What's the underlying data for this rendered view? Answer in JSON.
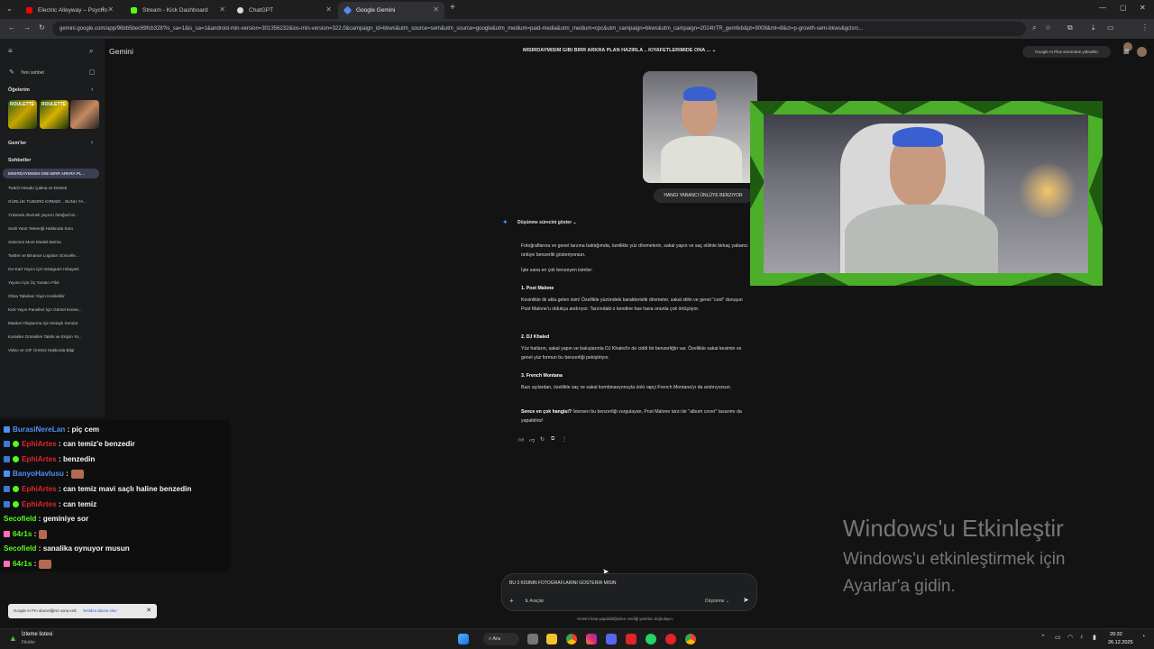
{
  "tabs": [
    {
      "label": "Electric Alleyway – Psycho",
      "color": "#ff0000"
    },
    {
      "label": "Stream - Kick Dashboard",
      "color": "#53fc18"
    },
    {
      "label": "ChatGPT",
      "color": "#ffffff"
    },
    {
      "label": "Google Gemini",
      "color": "#4e8cf5"
    }
  ],
  "new_tab": "+",
  "url": "gemini.google.com/app/96bb5bec69fcb328?is_sa=1&is_sa=1&android-min-version=301356232&ios-min-version=322.0&campaign_id=bkws&utm_source=sem&utm_source=google&utm_medium=paid-media&utm_medium=cpc&utm_campaign=bkws&utm_campaign=2024trTR_gemfeb&pt=9008&mt=8&ct=p-growth-sem-bkws&gclsrc...",
  "brand": "Gemini",
  "conversation_title": "MISIRDAYMISIM GIBI BIRR ARKRA PLAN HAZIRLA .. KIYAFETLERIMIDE ONA ...",
  "upgrade_label": "Google AI Plus sürümüne yükseltin",
  "sidebar": {
    "new_chat": "Yeni sohbet",
    "gems_heading": "Öğelerim",
    "gem_list_heading": "Gem'ler",
    "chats_heading": "Sohbetler",
    "chats": [
      "MISIRDAYMISIM GIBI BIRR ARKRA PL...",
      "Twitch Hesabı Çalma ve Destek",
      "GÜRLÜK TUBORG KIRMIZI .. BUNU YA...",
      "Yüzünde dövmeli yayıncı fotoğraf ist...",
      "Sesli Yanıt Yeteneği Hakkında Soru",
      "Salomon Mont Modeli Bulma",
      "Twitter ve Binance Logoları Güncelle...",
      "Go-Kart Yayını için Instagram Hikayesi",
      "Yayıncı İçin Üç Yaratıcı Fikir",
      "Obsa Tabelası Yayın Kesilebilir",
      "Kick Yayın Panelleri İçin Görsel Konse...",
      "Maskot Oluşturma İçin Detaylı Sorular",
      "Karakter Görselleri Talebi ve Erişim Yo...",
      "Video ve GIF Üretimi Hakkında Bilgi"
    ]
  },
  "user_message": "HANGI YABANCI ÜNLÜYE BENZIYOR",
  "thinking_label": "Düşünme sürecini göster",
  "response": {
    "intro": "Fotoğraflarına ve genel tarzına baktığımda, özellikle yüz dövmelerin, sakal yapın ve saç stilinle birkaç yabancı ünlüye benzerlik gösteriyorsun.",
    "lead": "İşte sana en çok benzeyen isimler:",
    "items": [
      {
        "title": "1. Post Malone",
        "body": "Kesinlikle ilk akla gelen isim! Özellikle yüzündeki karakteristik dövmeler, sakal stilin ve genel \"cool\" duruşun Post Malone'u oldukça andırıyor. Tarzındaki o kendine has hava onunla çok örtüşüyor."
      },
      {
        "title": "2. DJ Khaled",
        "body": "Yüz hatların, sakal yapın ve bakışlarınla DJ Khaled'e de ciddi bir benzerliğin var. Özellikle sakal kesimin ve genel yüz formun bu benzerliği pekiştiriyor."
      },
      {
        "title": "3. French Montana",
        "body": "Bazı açılardan, özellikle saç ve sakal kombinasyonuyla ünlü rapçi French Montana'yı da andırıyorsun."
      }
    ],
    "closing_bold": "Sence en çok hangisi?",
    "closing": " İstersen bu benzerliği vurgulayan, Post Malone tarzı bir \"album cover\" tasarımı da yapabiliriz!"
  },
  "input": {
    "value": "BU 3 KISININ FOTOGRAFLARINI GOSTERIR MISIN",
    "tools_label": "Araçlar",
    "mode_label": "Düşünme"
  },
  "disclaimer": "Gemini hata yapabildiğinden verdiği yanıtları doğrulayın.",
  "stream_chat": [
    {
      "user": "BurasiNereLan",
      "color": "#4f8ef7",
      "msg": "piç cem",
      "emote": false
    },
    {
      "user": "EphiArtes",
      "color": "#e0242c",
      "msg": "can temiz'e benzedir",
      "emote": false
    },
    {
      "user": "EphiArtes",
      "color": "#e0242c",
      "msg": "benzedin",
      "emote": false
    },
    {
      "user": "BanyoHavlusu",
      "color": "#4f8ef7",
      "msg": "",
      "emote": true
    },
    {
      "user": "EphiArtes",
      "color": "#e0242c",
      "msg": "can temiz mavi saçlı haline benzedin",
      "emote": false
    },
    {
      "user": "EphiArtes",
      "color": "#e0242c",
      "msg": "can temiz",
      "emote": false
    },
    {
      "user": "Secofield",
      "color": "#53fc18",
      "msg": "geminiye sor",
      "emote": false
    },
    {
      "user": "64r1s",
      "color": "#53fc18",
      "msg": "",
      "emote": true
    },
    {
      "user": "Secofield",
      "color": "#53fc18",
      "msg": "sanalika oynuyor musun",
      "emote": false
    },
    {
      "user": "64r1s",
      "color": "#53fc18",
      "msg": "",
      "emote": true
    }
  ],
  "activation": {
    "title": "Windows'u Etkinleştir",
    "line1": "Windows'u etkinleştirmek için",
    "line2": "Ayarlar'a gidin."
  },
  "toast": {
    "text": "Google AI Pro aboneliğiniz sona erdi",
    "action": "Yeniden abone olun"
  },
  "taskbar": {
    "widget_title": "İzleme listesi",
    "widget_sub": "Fikirler",
    "search": "Ara",
    "time": "20:32",
    "date": "26.12.2025"
  }
}
